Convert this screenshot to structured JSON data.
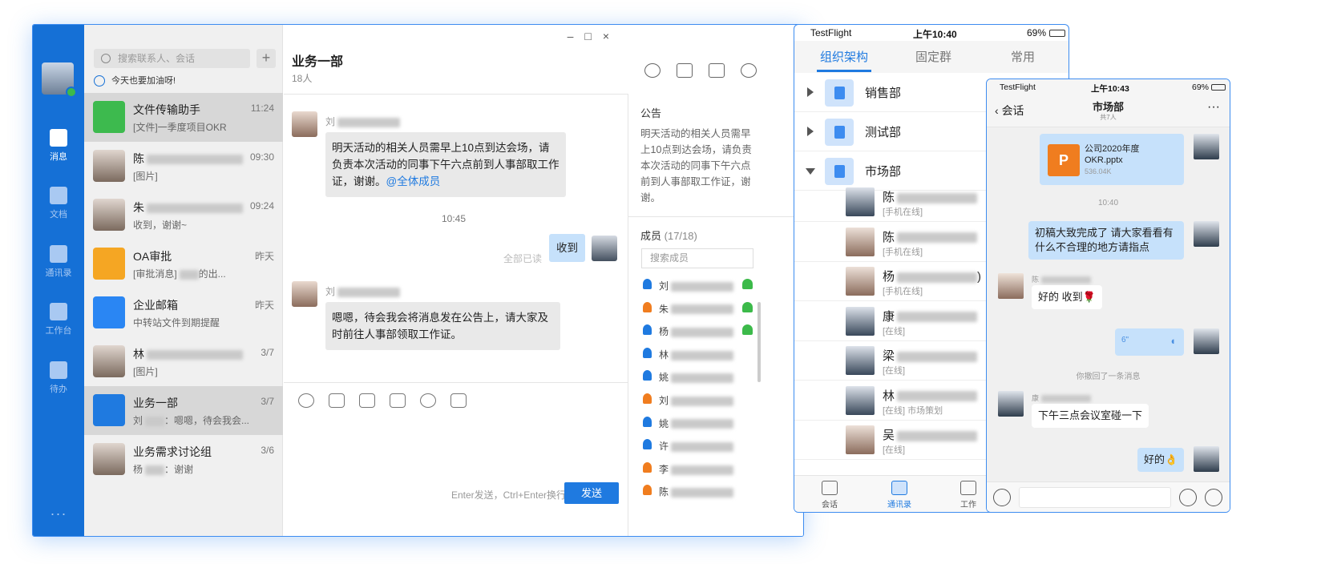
{
  "desktop": {
    "nav": [
      {
        "label": "消息",
        "icon": "message-icon",
        "active": true
      },
      {
        "label": "文档",
        "icon": "document-icon",
        "active": false
      },
      {
        "label": "通讯录",
        "icon": "contacts-icon",
        "active": false
      },
      {
        "label": "工作台",
        "icon": "workbench-icon",
        "active": false
      },
      {
        "label": "待办",
        "icon": "todo-icon",
        "active": false
      }
    ],
    "more": "···",
    "search_placeholder": "搜索联系人、会话",
    "add": "+",
    "motto": "今天也要加油呀!",
    "conversations": [
      {
        "name": "文件传输助手",
        "time": "11:24",
        "msg": "[文件]一季度项目OKR",
        "color": "#3dba4e"
      },
      {
        "name": "陈",
        "time": "09:30",
        "msg": "[图片]",
        "color": ""
      },
      {
        "name": "朱",
        "time": "09:24",
        "msg": "收到，谢谢~",
        "color": ""
      },
      {
        "name": "OA审批",
        "time": "昨天",
        "msg": "[审批消息]",
        "msg2": "的出...",
        "color": "#f5a623"
      },
      {
        "name": "企业邮箱",
        "time": "昨天",
        "msg": "中转站文件到期提醒",
        "color": "#2a86f3"
      },
      {
        "name": "林",
        "time": "3/7",
        "msg": "[图片]",
        "color": ""
      },
      {
        "name": "业务一部",
        "time": "3/7",
        "msg": "刘",
        "msg2": "：嗯嗯，待会我会...",
        "color": "#1f7ae0"
      },
      {
        "name": "业务需求讨论组",
        "time": "3/6",
        "msg": "杨",
        "msg2": "：谢谢",
        "color": ""
      }
    ],
    "chat": {
      "title": "业务一部",
      "count": "18人",
      "sender1": "刘",
      "msg1": "明天活动的相关人员需早上10点到达会场，请负责本次活动的同事下午六点前到人事部取工作证，谢谢。",
      "mention": "@全体成员",
      "time": "10:45",
      "read": "全部已读",
      "reply": "收到",
      "sender2": "刘",
      "msg2": "嗯嗯，待会我会将消息发在公告上，请大家及时前往人事部领取工作证。",
      "hint": "Enter发送，Ctrl+Enter换行",
      "send": "发送"
    },
    "side": {
      "notice_title": "公告",
      "notice": "明天活动的相关人员需早上10点到达会场，请负责本次活动的同事下午六点前到人事部取工作证，谢谢。",
      "members_title": "成员",
      "members_count": "(17/18)",
      "member_search": "搜索成员",
      "members": [
        {
          "name": "刘",
          "color": "#1f7ae0",
          "status": true
        },
        {
          "name": "朱",
          "color": "#f07d1f",
          "status": true
        },
        {
          "name": "杨",
          "color": "#1f7ae0",
          "status": true
        },
        {
          "name": "林",
          "color": "#1f7ae0",
          "status": false
        },
        {
          "name": "姚",
          "color": "#1f7ae0",
          "status": false
        },
        {
          "name": "刘",
          "color": "#f07d1f",
          "status": false
        },
        {
          "name": "姚",
          "color": "#1f7ae0",
          "status": false
        },
        {
          "name": "许",
          "color": "#1f7ae0",
          "status": false
        },
        {
          "name": "李",
          "color": "#f07d1f",
          "status": false
        },
        {
          "name": "陈",
          "color": "#f07d1f",
          "status": false
        }
      ]
    }
  },
  "phone1": {
    "carrier": "TestFlight",
    "time": "上午10:40",
    "battery": "69%",
    "tabs": [
      "组织架构",
      "固定群",
      "常用"
    ],
    "depts": [
      {
        "name": "销售部",
        "open": false
      },
      {
        "name": "测试部",
        "open": false
      },
      {
        "name": "市场部",
        "open": true
      }
    ],
    "people": [
      {
        "name": "陈",
        "status": "[手机在线]",
        "female": false
      },
      {
        "name": "陈",
        "status": "[手机在线]",
        "female": true
      },
      {
        "name": "杨",
        "suffix": ")",
        "status": "[手机在线]",
        "female": true
      },
      {
        "name": "康",
        "status": "[在线]",
        "female": false
      },
      {
        "name": "梁",
        "status": "[在线]",
        "female": false
      },
      {
        "name": "林",
        "status": "[在线] 市场策划",
        "female": false
      },
      {
        "name": "吴",
        "status": "[在线]",
        "female": true
      }
    ],
    "bottom": [
      {
        "label": "会话",
        "active": false
      },
      {
        "label": "通讯录",
        "active": true
      },
      {
        "label": "工作",
        "active": false
      }
    ]
  },
  "phone2": {
    "carrier": "TestFlight",
    "time": "上午10:43",
    "battery": "69%",
    "back": "会话",
    "title": "市场部",
    "subtitle": "共7人",
    "menu": "···",
    "file_name": "公司2020年度OKR.pptx",
    "file_size": "536.04K",
    "file_icon": "P",
    "time1": "10:40",
    "msg1": "初稿大致完成了 请大家看看有什么不合理的地方请指点",
    "sender_a": "陈",
    "msg2": "好的 收到🌹",
    "voice": "6\"",
    "recall": "你撤回了一条消息",
    "sender_b": "康",
    "msg3": "下午三点会议室碰一下",
    "msg4": "好的👌"
  }
}
